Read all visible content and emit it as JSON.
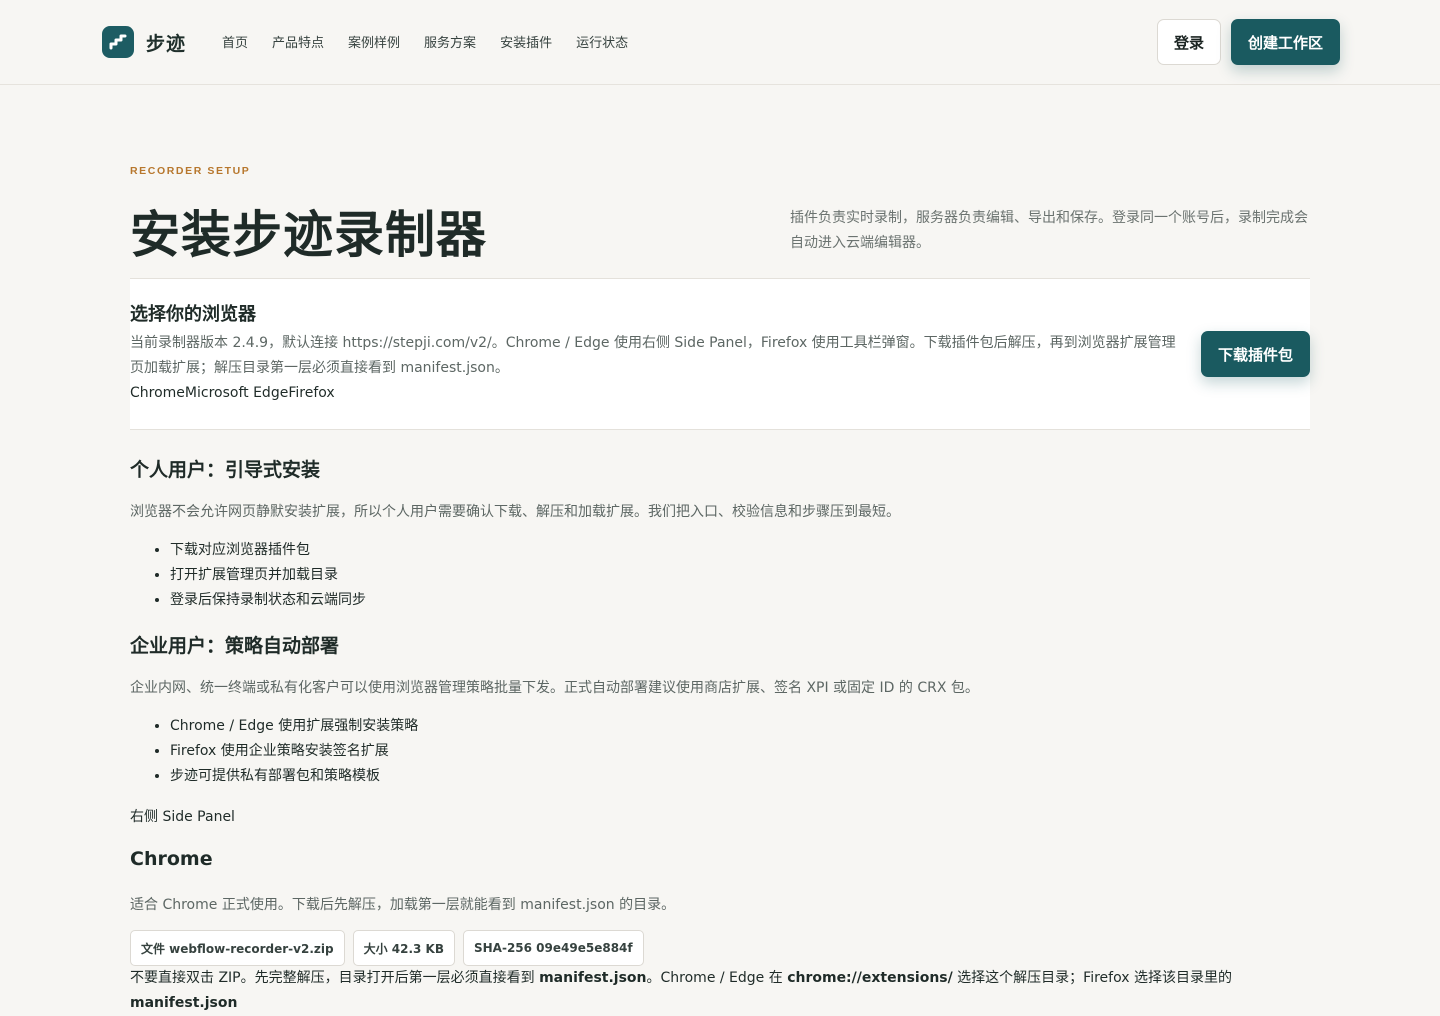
{
  "header": {
    "brand_name": "步迹",
    "logo_icon": "stairs-logo-icon",
    "nav": [
      "首页",
      "产品特点",
      "案例样例",
      "服务方案",
      "安装插件",
      "运行状态"
    ],
    "login_label": "登录",
    "create_label": "创建工作区"
  },
  "hero": {
    "eyebrow": "RECORDER SETUP",
    "title": "安装步迹录制器",
    "description": "插件负责实时录制，服务器负责编辑、导出和保存。登录同一个账号后，录制完成会自动进入云端编辑器。"
  },
  "browser_panel": {
    "title": "选择你的浏览器",
    "description": "当前录制器版本 2.4.9，默认连接 https://stepji.com/v2/。Chrome / Edge 使用右侧 Side Panel，Firefox 使用工具栏弹窗。下载插件包后解压，再到浏览器扩展管理页加载扩展；解压目录第一层必须直接看到 manifest.json。",
    "tabs": [
      "Chrome",
      "Microsoft Edge",
      "Firefox"
    ],
    "download_label": "下载插件包"
  },
  "personal": {
    "title": "个人用户：引导式安装",
    "description": "浏览器不会允许网页静默安装扩展，所以个人用户需要确认下载、解压和加载扩展。我们把入口、校验信息和步骤压到最短。",
    "steps": [
      "下载对应浏览器插件包",
      "打开扩展管理页并加载目录",
      "登录后保持录制状态和云端同步"
    ]
  },
  "enterprise": {
    "title": "企业用户：策略自动部署",
    "description": "企业内网、统一终端或私有化客户可以使用浏览器管理策略批量下发。正式自动部署建议使用商店扩展、签名 XPI 或固定 ID 的 CRX 包。",
    "steps": [
      "Chrome / Edge 使用扩展强制安装策略",
      "Firefox 使用企业策略安装签名扩展",
      "步迹可提供私有部署包和策略模板"
    ]
  },
  "side_panel_label": "右侧 Side Panel",
  "chrome": {
    "title": "Chrome",
    "description": "适合 Chrome 正式使用。下载后先解压，加载第一层就能看到 manifest.json 的目录。",
    "chips": [
      "文件 webflow-recorder-v2.zip",
      "大小 42.3 KB",
      "SHA-256 09e49e5e884f"
    ],
    "note_part1": "不要直接双击 ZIP。先完整解压，目录打开后第一层必须直接看到 ",
    "note_bold1": "manifest.json",
    "note_part2": "。Chrome / Edge 在 ",
    "note_bold2": "chrome://extensions/",
    "note_part3": " 选择这个解压目录；Firefox 选择该目录里的 ",
    "note_bold3": "manifest.json"
  },
  "colors": {
    "accent": "#1a5a60",
    "eyebrow": "#b7772d",
    "background": "#f7f6f3"
  }
}
